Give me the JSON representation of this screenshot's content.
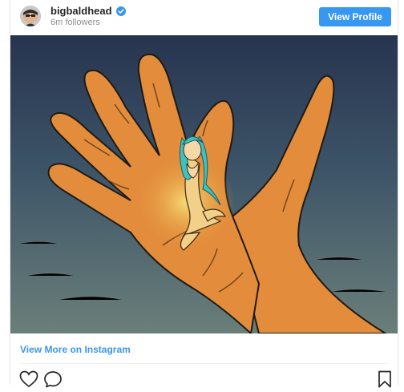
{
  "post_header": {
    "username": "bigbaldhead",
    "followers": "6m followers",
    "view_profile_label": "View Profile"
  },
  "footer": {
    "view_more_label": "View More on Instagram"
  },
  "icons": {
    "verified": "verified-badge-icon",
    "like": "heart-icon",
    "comment": "comment-bubble-icon",
    "save": "bookmark-icon"
  },
  "colors": {
    "accent": "#3897f0",
    "username": "#262626",
    "muted": "#8e8e8e"
  }
}
